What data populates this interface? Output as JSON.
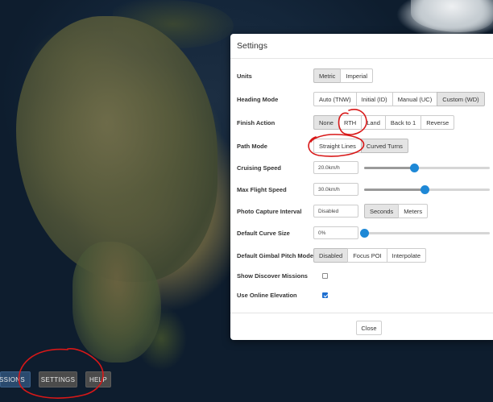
{
  "toolbar": {
    "missions_label": "MISSIONS",
    "missions_visible": "ISSIONS",
    "settings_label": "SETTINGS",
    "help_label": "HELP"
  },
  "dialog": {
    "title": "Settings",
    "close_label": "Close",
    "units": {
      "label": "Units",
      "options": [
        "Metric",
        "Imperial"
      ],
      "selected": "Metric"
    },
    "heading_mode": {
      "label": "Heading Mode",
      "options": [
        "Auto (TNW)",
        "Initial (ID)",
        "Manual (UC)",
        "Custom (WD)"
      ],
      "selected": "Custom (WD)"
    },
    "finish_action": {
      "label": "Finish Action",
      "options": [
        "None",
        "RTH",
        "Land",
        "Back to 1",
        "Reverse"
      ],
      "selected": "None"
    },
    "path_mode": {
      "label": "Path Mode",
      "options": [
        "Straight Lines",
        "Curved Turns"
      ],
      "selected": "Curved Turns"
    },
    "cruising_speed": {
      "label": "Cruising Speed",
      "value": "20.0km/h",
      "slider_fraction": 0.4
    },
    "max_flight_speed": {
      "label": "Max Flight Speed",
      "value": "30.0km/h",
      "slider_fraction": 0.48
    },
    "photo_capture_interval": {
      "label": "Photo Capture Interval",
      "value": "Disabled",
      "options": [
        "Seconds",
        "Meters"
      ],
      "selected": "Seconds"
    },
    "default_curve_size": {
      "label": "Default Curve Size",
      "value": "0%",
      "slider_fraction": 0.0
    },
    "default_gimbal_pitch_mode": {
      "label": "Default Gimbal Pitch Mode",
      "options": [
        "Disabled",
        "Focus POI",
        "Interpolate"
      ],
      "selected": "Disabled"
    },
    "show_discover_missions": {
      "label": "Show Discover Missions",
      "checked": false
    },
    "use_online_elevation": {
      "label": "Use Online Elevation",
      "checked": true
    }
  },
  "colors": {
    "slider_thumb": "#1e88d6",
    "annotation": "#d81818",
    "missions_button": "#2a4a6e"
  }
}
